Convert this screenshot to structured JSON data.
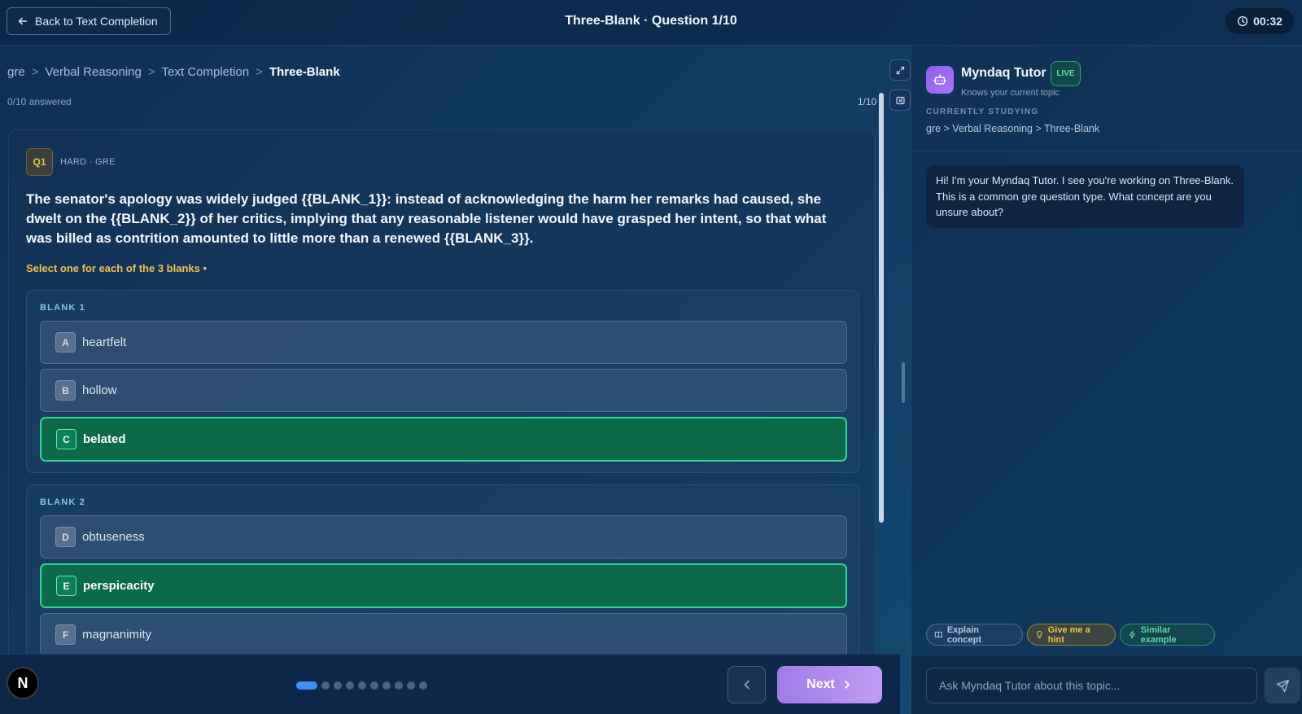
{
  "header": {
    "back_label": "Back to Text Completion",
    "title": "Three-Blank · Question 1/10",
    "timer": "00:32"
  },
  "breadcrumb": {
    "items": [
      "gre",
      "Verbal Reasoning",
      "Text Completion",
      "Three-Blank"
    ],
    "separator": ">"
  },
  "progress": {
    "answered": "0/10 answered",
    "count": "1/10",
    "current_index": 1,
    "total": 10
  },
  "question": {
    "badge": "Q1",
    "meta": "HARD · GRE",
    "text": "The senator's apology was widely judged {{BLANK_1}}: instead of acknowledging the harm her remarks had caused, she dwelt on the {{BLANK_2}} of her critics, implying that any reasonable listener would have grasped her intent, so that what was billed as contrition amounted to little more than a renewed {{BLANK_3}}.",
    "hint": "Select one for each of the 3 blanks",
    "blanks": [
      {
        "label": "BLANK 1",
        "options": [
          {
            "letter": "A",
            "text": "heartfelt",
            "selected": false
          },
          {
            "letter": "B",
            "text": "hollow",
            "selected": false
          },
          {
            "letter": "C",
            "text": "belated",
            "selected": true
          }
        ]
      },
      {
        "label": "BLANK 2",
        "options": [
          {
            "letter": "D",
            "text": "obtuseness",
            "selected": false
          },
          {
            "letter": "E",
            "text": "perspicacity",
            "selected": true
          },
          {
            "letter": "F",
            "text": "magnanimity",
            "selected": false
          }
        ]
      }
    ]
  },
  "nav": {
    "logo": "N",
    "next_label": "Next"
  },
  "tutor": {
    "name": "Myndaq Tutor",
    "live": "LIVE",
    "subtitle": "Knows your current topic",
    "studying_label": "CURRENTLY STUDYING",
    "studying_path": "gre > Verbal Reasoning > Three-Blank",
    "message": "Hi! I'm your Myndaq Tutor. I see you're working on Three-Blank. This is a common gre question type. What concept are you unsure about?",
    "quick_actions": {
      "explain": "Explain concept",
      "hint": "Give me a hint",
      "similar": "Similar example"
    },
    "input_placeholder": "Ask Myndaq Tutor about this topic..."
  },
  "colors": {
    "accent": "#3f8ef2",
    "selected": "#0b6a4a",
    "selected_border": "#36d69a",
    "warning": "#f2c14a",
    "next_button": "#a07be6"
  }
}
